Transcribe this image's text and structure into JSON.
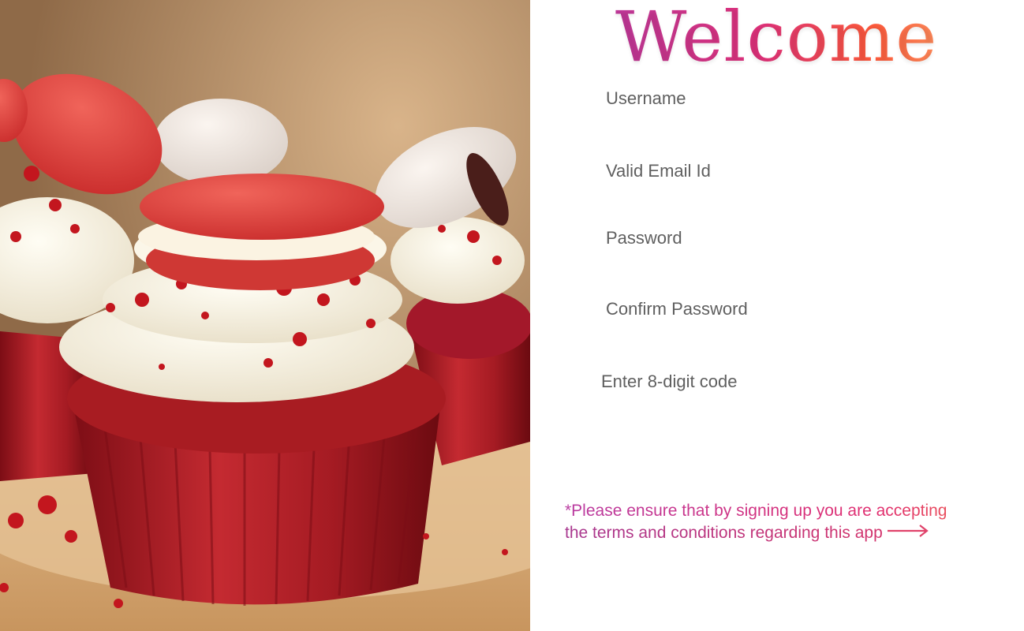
{
  "welcome": {
    "title": "Welcome"
  },
  "form": {
    "username_placeholder": "Username",
    "email_placeholder": "Valid Email Id",
    "password_placeholder": "Password",
    "confirm_password_placeholder": "Confirm Password",
    "code_placeholder": "Enter 8-digit code"
  },
  "terms": {
    "line1": "*Please ensure that by signing up you are accepting",
    "line2": "the terms and conditions regarding this app",
    "arrow_icon": "arrow-right-icon"
  },
  "image": {
    "subject": "red velvet cupcakes with macarons"
  },
  "colors": {
    "gradient_start": "#c0399a",
    "gradient_mid": "#e0317a",
    "gradient_end": "#ff8a5a",
    "placeholder_text": "#5f5f5f"
  }
}
